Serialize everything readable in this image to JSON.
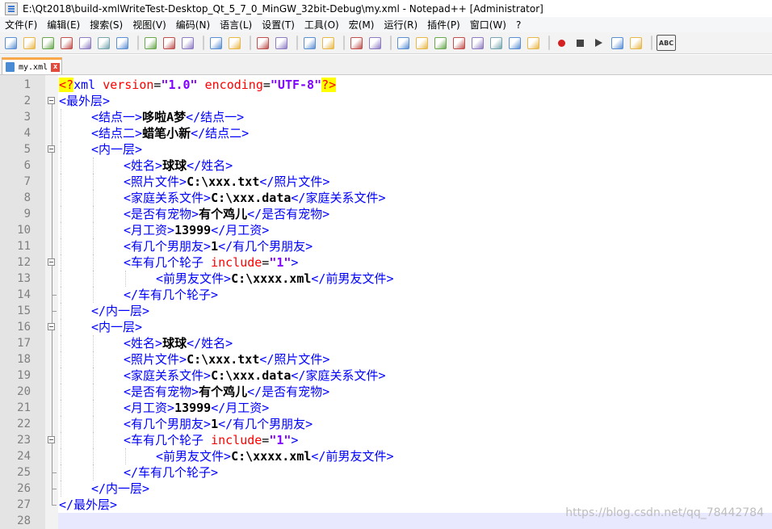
{
  "window": {
    "title": "E:\\Qt2018\\build-xmlWriteTest-Desktop_Qt_5_7_0_MinGW_32bit-Debug\\my.xml - Notepad++ [Administrator]"
  },
  "menu": [
    "文件(F)",
    "编辑(E)",
    "搜索(S)",
    "视图(V)",
    "编码(N)",
    "语言(L)",
    "设置(T)",
    "工具(O)",
    "宏(M)",
    "运行(R)",
    "插件(P)",
    "窗口(W)",
    "?"
  ],
  "toolbar": {
    "icons": [
      "new-icon",
      "open-icon",
      "save-icon",
      "save-all-icon",
      "close-icon",
      "close-all-icon",
      "print-icon",
      "sep",
      "cut-icon",
      "copy-icon",
      "paste-icon",
      "sep",
      "undo-icon",
      "redo-icon",
      "sep",
      "find-icon",
      "replace-icon",
      "sep",
      "zoom-in-icon",
      "zoom-out-icon",
      "sep",
      "sync-v-icon",
      "sync-h-icon",
      "sep",
      "wrap-icon",
      "all-chars-icon",
      "indent-guide-icon",
      "udl-icon",
      "doc-map-icon",
      "function-list-icon",
      "folder-icon",
      "monitor-icon",
      "sep",
      "record-icon",
      "stop-icon",
      "play-icon",
      "play-multi-icon",
      "save-macro-icon",
      "sep",
      "spellcheck-icon"
    ],
    "spell_label": "ABC"
  },
  "tab": {
    "label": "my.xml",
    "close": "x"
  },
  "lines": [
    {
      "n": "1",
      "indent": 0,
      "fold": "none",
      "parts": [
        [
          "pi",
          "<?"
        ],
        [
          "piname",
          "xml"
        ],
        [
          "plain",
          " "
        ],
        [
          "attr",
          "version"
        ],
        [
          "plain",
          "="
        ],
        [
          "str",
          "\"1.0\""
        ],
        [
          "plain",
          " "
        ],
        [
          "attr",
          "encoding"
        ],
        [
          "plain",
          "="
        ],
        [
          "str",
          "\"UTF-8\""
        ],
        [
          "pi",
          "?>"
        ]
      ]
    },
    {
      "n": "2",
      "indent": 0,
      "fold": "open",
      "parts": [
        [
          "tag",
          "<最外层>"
        ]
      ]
    },
    {
      "n": "3",
      "indent": 1,
      "fold": "line",
      "parts": [
        [
          "tag",
          "<结点一>"
        ],
        [
          "txt",
          "哆啦A梦"
        ],
        [
          "tag",
          "</结点一>"
        ]
      ]
    },
    {
      "n": "4",
      "indent": 1,
      "fold": "line",
      "parts": [
        [
          "tag",
          "<结点二>"
        ],
        [
          "txt",
          "蜡笔小新"
        ],
        [
          "tag",
          "</结点二>"
        ]
      ]
    },
    {
      "n": "5",
      "indent": 1,
      "fold": "open",
      "parts": [
        [
          "tag",
          "<内一层>"
        ]
      ]
    },
    {
      "n": "6",
      "indent": 2,
      "fold": "line",
      "parts": [
        [
          "tag",
          "<姓名>"
        ],
        [
          "txt",
          "球球"
        ],
        [
          "tag",
          "</姓名>"
        ]
      ]
    },
    {
      "n": "7",
      "indent": 2,
      "fold": "line",
      "parts": [
        [
          "tag",
          "<照片文件>"
        ],
        [
          "txt",
          "C:\\xxx.txt"
        ],
        [
          "tag",
          "</照片文件>"
        ]
      ]
    },
    {
      "n": "8",
      "indent": 2,
      "fold": "line",
      "parts": [
        [
          "tag",
          "<家庭关系文件>"
        ],
        [
          "txt",
          "C:\\xxx.data"
        ],
        [
          "tag",
          "</家庭关系文件>"
        ]
      ]
    },
    {
      "n": "9",
      "indent": 2,
      "fold": "line",
      "parts": [
        [
          "tag",
          "<是否有宠物>"
        ],
        [
          "txt",
          "有个鸡儿"
        ],
        [
          "tag",
          "</是否有宠物>"
        ]
      ]
    },
    {
      "n": "10",
      "indent": 2,
      "fold": "line",
      "parts": [
        [
          "tag",
          "<月工资>"
        ],
        [
          "txt",
          "13999"
        ],
        [
          "tag",
          "</月工资>"
        ]
      ]
    },
    {
      "n": "11",
      "indent": 2,
      "fold": "line",
      "parts": [
        [
          "tag",
          "<有几个男朋友>"
        ],
        [
          "txt",
          "1"
        ],
        [
          "tag",
          "</有几个男朋友>"
        ]
      ]
    },
    {
      "n": "12",
      "indent": 2,
      "fold": "open",
      "parts": [
        [
          "tag",
          "<车有几个轮子"
        ],
        [
          "plain",
          " "
        ],
        [
          "attr",
          "include"
        ],
        [
          "plain",
          "="
        ],
        [
          "str",
          "\"1\""
        ],
        [
          "tag",
          ">"
        ]
      ]
    },
    {
      "n": "13",
      "indent": 3,
      "fold": "line",
      "parts": [
        [
          "tag",
          "<前男友文件>"
        ],
        [
          "txt",
          "C:\\xxxx.xml"
        ],
        [
          "tag",
          "</前男友文件>"
        ]
      ]
    },
    {
      "n": "14",
      "indent": 2,
      "fold": "end",
      "parts": [
        [
          "tag",
          "</车有几个轮子>"
        ]
      ]
    },
    {
      "n": "15",
      "indent": 1,
      "fold": "end",
      "parts": [
        [
          "tag",
          "</内一层>"
        ]
      ]
    },
    {
      "n": "16",
      "indent": 1,
      "fold": "open",
      "parts": [
        [
          "tag",
          "<内一层>"
        ]
      ]
    },
    {
      "n": "17",
      "indent": 2,
      "fold": "line",
      "parts": [
        [
          "tag",
          "<姓名>"
        ],
        [
          "txt",
          "球球"
        ],
        [
          "tag",
          "</姓名>"
        ]
      ]
    },
    {
      "n": "18",
      "indent": 2,
      "fold": "line",
      "parts": [
        [
          "tag",
          "<照片文件>"
        ],
        [
          "txt",
          "C:\\xxx.txt"
        ],
        [
          "tag",
          "</照片文件>"
        ]
      ]
    },
    {
      "n": "19",
      "indent": 2,
      "fold": "line",
      "parts": [
        [
          "tag",
          "<家庭关系文件>"
        ],
        [
          "txt",
          "C:\\xxx.data"
        ],
        [
          "tag",
          "</家庭关系文件>"
        ]
      ]
    },
    {
      "n": "20",
      "indent": 2,
      "fold": "line",
      "parts": [
        [
          "tag",
          "<是否有宠物>"
        ],
        [
          "txt",
          "有个鸡儿"
        ],
        [
          "tag",
          "</是否有宠物>"
        ]
      ]
    },
    {
      "n": "21",
      "indent": 2,
      "fold": "line",
      "parts": [
        [
          "tag",
          "<月工资>"
        ],
        [
          "txt",
          "13999"
        ],
        [
          "tag",
          "</月工资>"
        ]
      ]
    },
    {
      "n": "22",
      "indent": 2,
      "fold": "line",
      "parts": [
        [
          "tag",
          "<有几个男朋友>"
        ],
        [
          "txt",
          "1"
        ],
        [
          "tag",
          "</有几个男朋友>"
        ]
      ]
    },
    {
      "n": "23",
      "indent": 2,
      "fold": "open",
      "parts": [
        [
          "tag",
          "<车有几个轮子"
        ],
        [
          "plain",
          " "
        ],
        [
          "attr",
          "include"
        ],
        [
          "plain",
          "="
        ],
        [
          "str",
          "\"1\""
        ],
        [
          "tag",
          ">"
        ]
      ]
    },
    {
      "n": "24",
      "indent": 3,
      "fold": "line",
      "parts": [
        [
          "tag",
          "<前男友文件>"
        ],
        [
          "txt",
          "C:\\xxxx.xml"
        ],
        [
          "tag",
          "</前男友文件>"
        ]
      ]
    },
    {
      "n": "25",
      "indent": 2,
      "fold": "end",
      "parts": [
        [
          "tag",
          "</车有几个轮子>"
        ]
      ]
    },
    {
      "n": "26",
      "indent": 1,
      "fold": "end",
      "parts": [
        [
          "tag",
          "</内一层>"
        ]
      ]
    },
    {
      "n": "27",
      "indent": 0,
      "fold": "end",
      "parts": [
        [
          "tag",
          "</最外层>"
        ]
      ]
    },
    {
      "n": "28",
      "indent": 0,
      "fold": "none",
      "current": true,
      "parts": []
    }
  ],
  "watermark": "https://blog.csdn.net/qq_78442784"
}
